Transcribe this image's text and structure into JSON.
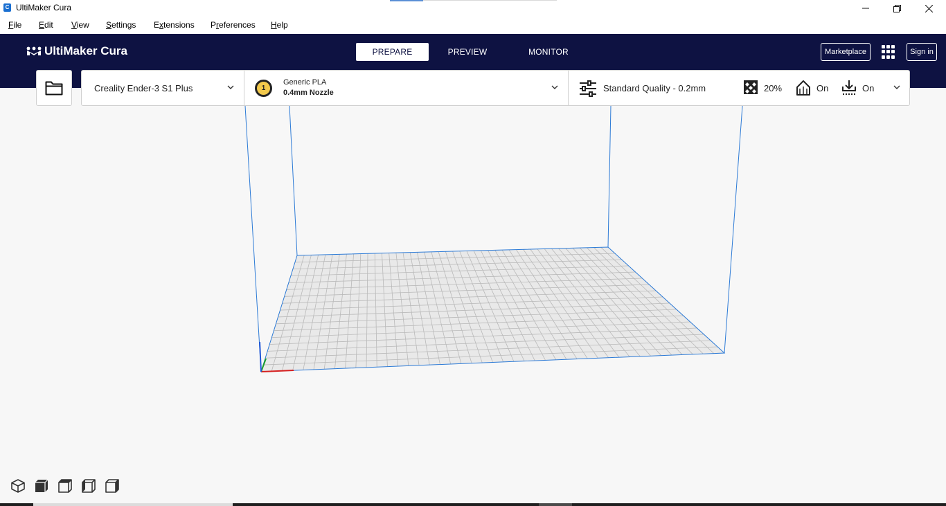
{
  "window": {
    "title": "UltiMaker Cura",
    "app_icon": "C"
  },
  "menu": {
    "items": [
      {
        "label": "File",
        "mnemonic": "F",
        "rest": "ile"
      },
      {
        "label": "Edit",
        "mnemonic": "E",
        "rest": "dit"
      },
      {
        "label": "View",
        "mnemonic": "V",
        "rest": "iew"
      },
      {
        "label": "Settings",
        "mnemonic": "S",
        "rest": "ettings"
      },
      {
        "label": "Extensions",
        "mnemonic": "x",
        "pre": "E",
        "rest": "tensions"
      },
      {
        "label": "Preferences",
        "mnemonic": "r",
        "pre": "P",
        "rest": "eferences"
      },
      {
        "label": "Help",
        "mnemonic": "H",
        "rest": "elp"
      }
    ]
  },
  "header": {
    "logo_text": "UltiMaker Cura",
    "tabs": [
      "PREPARE",
      "PREVIEW",
      "MONITOR"
    ],
    "active_tab": "PREPARE",
    "marketplace_label": "Marketplace",
    "signin_label": "Sign in"
  },
  "toolbar": {
    "printer": "Creality Ender-3 S1 Plus",
    "extruder_number": "1",
    "material": "Generic PLA",
    "nozzle": "0.4mm Nozzle",
    "profile": "Standard Quality - 0.2mm",
    "infill": "20%",
    "support": "On",
    "adhesion": "On"
  },
  "colors": {
    "header_bg": "#0e1242",
    "extruder_color": "#f2c94c",
    "build_volume_line": "#2c7ad6",
    "axis_x": "#d62020",
    "axis_y": "#1a9e2a",
    "axis_z": "#2056d6"
  },
  "view_buttons": [
    "3d-view-icon",
    "front-view-icon",
    "top-view-icon",
    "left-view-icon",
    "right-view-icon"
  ]
}
